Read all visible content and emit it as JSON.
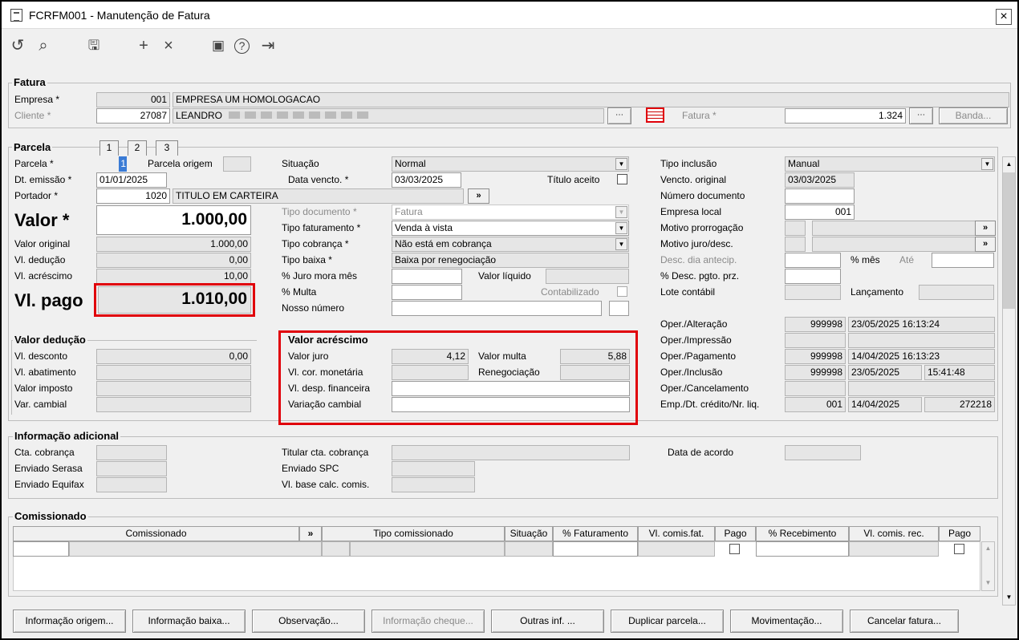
{
  "window": {
    "title": "FCRFM001 - Manutenção de Fatura",
    "close": "×"
  },
  "toolbar": {
    "undo": "↺",
    "search": "⌕",
    "save": "🖫",
    "add": "+",
    "delete": "×",
    "calendar": "▣",
    "help": "?",
    "exit": "⇥"
  },
  "fatura": {
    "group": "Fatura",
    "empresa_label": "Empresa *",
    "empresa_code": "001",
    "empresa_name": "EMPRESA UM HOMOLOGACAO",
    "cliente_label": "Cliente *",
    "cliente_code": "27087",
    "cliente_name": "LEANDRO",
    "fatura_label": "Fatura *",
    "fatura_value": "1.324",
    "banda_button": "Banda..."
  },
  "parcela": {
    "group": "Parcela",
    "tabs": [
      "1",
      "2",
      "3"
    ],
    "parcela_label": "Parcela *",
    "parcela_value": "1",
    "parcela_origem_label": "Parcela origem",
    "dt_emissao_label": "Dt. emissão *",
    "dt_emissao": "01/01/2025",
    "portador_label": "Portador *",
    "portador_code": "1020",
    "portador_name": "TITULO EM CARTEIRA",
    "valor_label": "Valor *",
    "valor": "1.000,00",
    "valor_original_label": "Valor original",
    "valor_original": "1.000,00",
    "vl_deducao_label": "Vl. dedução",
    "vl_deducao": "0,00",
    "vl_acrescimo_label": "Vl. acréscimo",
    "vl_acrescimo": "10,00",
    "vl_pago_label": "Vl. pago",
    "vl_pago": "1.010,00"
  },
  "middle": {
    "situacao_label": "Situação",
    "situacao": "Normal",
    "data_vencto_label": "Data vencto. *",
    "data_vencto": "03/03/2025",
    "titulo_aceito_label": "Título aceito",
    "tipo_documento_label": "Tipo documento *",
    "tipo_documento": "Fatura",
    "tipo_faturamento_label": "Tipo faturamento *",
    "tipo_faturamento": "Venda à vista",
    "tipo_cobranca_label": "Tipo cobrança *",
    "tipo_cobranca": "Não está em cobrança",
    "tipo_baixa_label": "Tipo baixa *",
    "tipo_baixa": "Baixa por renegociação",
    "juro_mora_label": "% Juro mora mês",
    "valor_liquido_label": "Valor líquido",
    "multa_label": "% Multa",
    "contabilizado_label": "Contabilizado",
    "nosso_numero_label": "Nosso número"
  },
  "right": {
    "tipo_inclusao_label": "Tipo inclusão",
    "tipo_inclusao": "Manual",
    "vencto_original_label": "Vencto. original",
    "vencto_original": "03/03/2025",
    "numero_documento_label": "Número documento",
    "empresa_local_label": "Empresa local",
    "empresa_local": "001",
    "motivo_prorrogacao_label": "Motivo prorrogação",
    "motivo_juro_label": "Motivo juro/desc.",
    "desc_dia_antecip_label": "Desc. dia antecip.",
    "pct_mes_label": "% mês",
    "ate_label": "Até",
    "desc_pgto_label": "% Desc. pgto. prz.",
    "lote_contabil_label": "Lote contábil",
    "lancamento_label": "Lançamento",
    "oper_alteracao_label": "Oper./Alteração",
    "oper_alteracao_code": "999998",
    "oper_alteracao_dt": "23/05/2025 16:13:24",
    "oper_impressao_label": "Oper./Impressão",
    "oper_pagamento_label": "Oper./Pagamento",
    "oper_pagamento_code": "999998",
    "oper_pagamento_dt": "14/04/2025 16:13:23",
    "oper_inclusao_label": "Oper./Inclusão",
    "oper_inclusao_code": "999998",
    "oper_inclusao_date": "23/05/2025",
    "oper_inclusao_time": "15:41:48",
    "oper_cancelamento_label": "Oper./Cancelamento",
    "emp_dt_credito_label": "Emp./Dt. crédito/Nr. liq.",
    "emp_code": "001",
    "dt_credito": "14/04/2025",
    "nr_liq": "272218"
  },
  "valor_deducao": {
    "group": "Valor dedução",
    "vl_desconto_label": "Vl. desconto",
    "vl_desconto": "0,00",
    "vl_abatimento_label": "Vl. abatimento",
    "valor_imposto_label": "Valor imposto",
    "var_cambial_label": "Var. cambial"
  },
  "valor_acrescimo": {
    "group": "Valor acréscimo",
    "valor_juro_label": "Valor juro",
    "valor_juro": "4,12",
    "valor_multa_label": "Valor multa",
    "valor_multa": "5,88",
    "vl_cor_monetaria_label": "Vl. cor. monetária",
    "renegociacao_label": "Renegociação",
    "vl_desp_financeira_label": "Vl. desp. financeira",
    "variacao_cambial_label": "Variação cambial"
  },
  "info_adicional": {
    "group": "Informação adicional",
    "cta_cobranca_label": "Cta. cobrança",
    "enviado_serasa_label": "Enviado Serasa",
    "enviado_equifax_label": "Enviado Equifax",
    "titular_cta_label": "Titular cta. cobrança",
    "enviado_spc_label": "Enviado SPC",
    "vl_base_calc_label": "Vl. base calc. comis.",
    "data_acordo_label": "Data de acordo"
  },
  "comissionado": {
    "group": "Comissionado",
    "headers": [
      "Comissionado",
      "»",
      "Tipo comissionado",
      "Situação",
      "% Faturamento",
      "Vl. comis.fat.",
      "Pago",
      "% Recebimento",
      "Vl. comis. rec.",
      "Pago"
    ]
  },
  "buttons": [
    "Informação origem...",
    "Informação baixa...",
    "Observação...",
    "Informação cheque...",
    "Outras inf. ...",
    "Duplicar parcela...",
    "Movimentação...",
    "Cancelar fatura..."
  ],
  "misc": {
    "more": "»",
    "dots": "⋯",
    "dropdown": "▼",
    "up": "▲",
    "down": "▼"
  }
}
